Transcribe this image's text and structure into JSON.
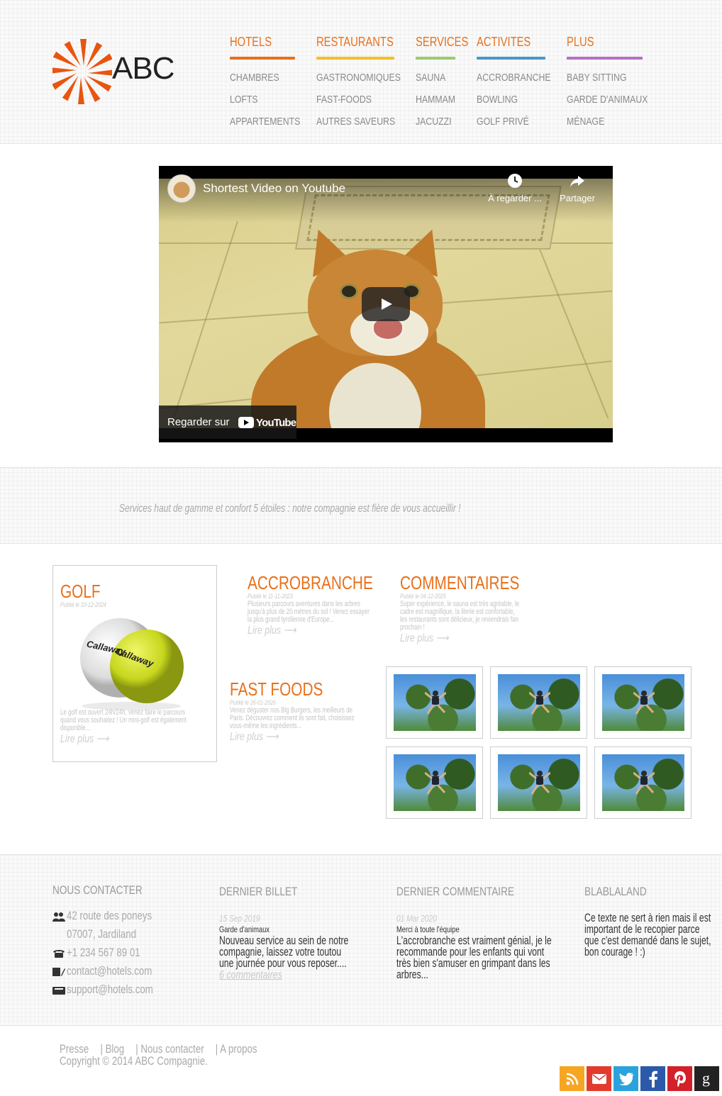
{
  "logo": {
    "text": "ABC",
    "color": "#e8550f"
  },
  "nav": [
    {
      "label": "HOTELS",
      "color": "#e8701a",
      "items": [
        "CHAMBRES",
        "LOFTS",
        "APPARTEMENTS"
      ]
    },
    {
      "label": "RESTAURANTS",
      "color": "#f2c029",
      "items": [
        "GASTRONOMIQUES",
        "FAST-FOODS",
        "AUTRES SAVEURS"
      ]
    },
    {
      "label": "SERVICES",
      "color": "#9bcb6b",
      "items": [
        "SAUNA",
        "HAMMAM",
        "JACUZZI"
      ]
    },
    {
      "label": "ACTIVITES",
      "color": "#4b97c9",
      "items": [
        "ACCROBRANCHE",
        "BOWLING",
        "GOLF PRIVÉ"
      ]
    },
    {
      "label": "PLUS",
      "color": "#b66fc8",
      "items": [
        "BABY SITTING",
        "GARDE D'ANIMAUX",
        "MÉNAGE"
      ]
    }
  ],
  "video": {
    "title": "Shortest Video on Youtube",
    "watch_later": "À regarder ...",
    "share": "Partager",
    "watch_on": "Regarder sur",
    "youtube": "YouTube"
  },
  "tagline": "Services haut de gamme et confort 5 étoiles : notre compagnie est fière de vous accueillir !",
  "posts": {
    "golf": {
      "title": "GOLF",
      "date": "Publié le 10-12-2024",
      "excerpt": "Le golf est ouvert 24h/24h, venez faire le parcours quand vous souhaitez ! Un mini-golf est également disponible...",
      "more": "Lire plus"
    },
    "accrobranche": {
      "title": "ACCROBRANCHE",
      "date": "Publié le 11-11-2023",
      "excerpt": "Plusieurs parcours aventures dans les arbres jusqu'à plus de 20 mètres du sol ! Venez essayer la plus grand tyrolienne d'Europe...",
      "more": "Lire plus"
    },
    "commentaires": {
      "title": "COMMENTAIRES",
      "date": "Publié le 04-12-2025",
      "excerpt": "Super expérience, le sauna est très agréable, le cadre est magnifique, la literie est confortable, les restaurants sont délicieux, je reviendrais fan prochain !",
      "more": "Lire plus"
    },
    "fastfoods": {
      "title": "FAST FOODS",
      "date": "Publié le 26-01-2026",
      "excerpt": "Venez déguster nos Big Burgers, les meilleurs de Paris. Découvrez comment ils sont fait, choisissez vous-même les ingrédients...",
      "more": "Lire plus"
    }
  },
  "gallery_count_label": "",
  "footer": {
    "contact": {
      "heading": "NOUS CONTACTER",
      "address1": "42 route des poneys",
      "address2": "07007, Jardiland",
      "phone": "+1 234 567 89 01",
      "email1": "contact@hotels.com",
      "email2": "support@hotels.com"
    },
    "last_post": {
      "heading": "DERNIER BILLET",
      "date": "15 Sep 2019",
      "title": "Garde d'animaux",
      "text": "Nouveau service au sein de notre compagnie, laissez votre toutou une journée pour vous reposer....",
      "comments": "6 commentaires"
    },
    "last_comment": {
      "heading": "DERNIER COMMENTAIRE",
      "date": "01 Mar 2020",
      "title": "Merci à toute l'équipe",
      "text": "L'accrobranche est vraiment génial, je le recommande pour les enfants qui vont très bien s'amuser en grimpant dans les arbres..."
    },
    "blabla": {
      "heading": "BLABLALAND",
      "text": "Ce texte ne sert à rien mais il est important de le recopier parce que c'est demandé dans le sujet, bon courage ! :)"
    }
  },
  "bottom": {
    "links": [
      "Presse",
      "| Blog",
      "| Nous contacter",
      "| A propos"
    ],
    "copyright": "Copyright © 2014 ABC Compagnie."
  },
  "social": [
    {
      "name": "rss-icon",
      "color": "#f6a623"
    },
    {
      "name": "email-icon",
      "color": "#e23b2e"
    },
    {
      "name": "twitter-icon",
      "color": "#2aa3dd"
    },
    {
      "name": "facebook-icon",
      "color": "#2c5aa8"
    },
    {
      "name": "pinterest-icon",
      "color": "#d3202b"
    },
    {
      "name": "google-icon",
      "color": "#222222"
    }
  ]
}
